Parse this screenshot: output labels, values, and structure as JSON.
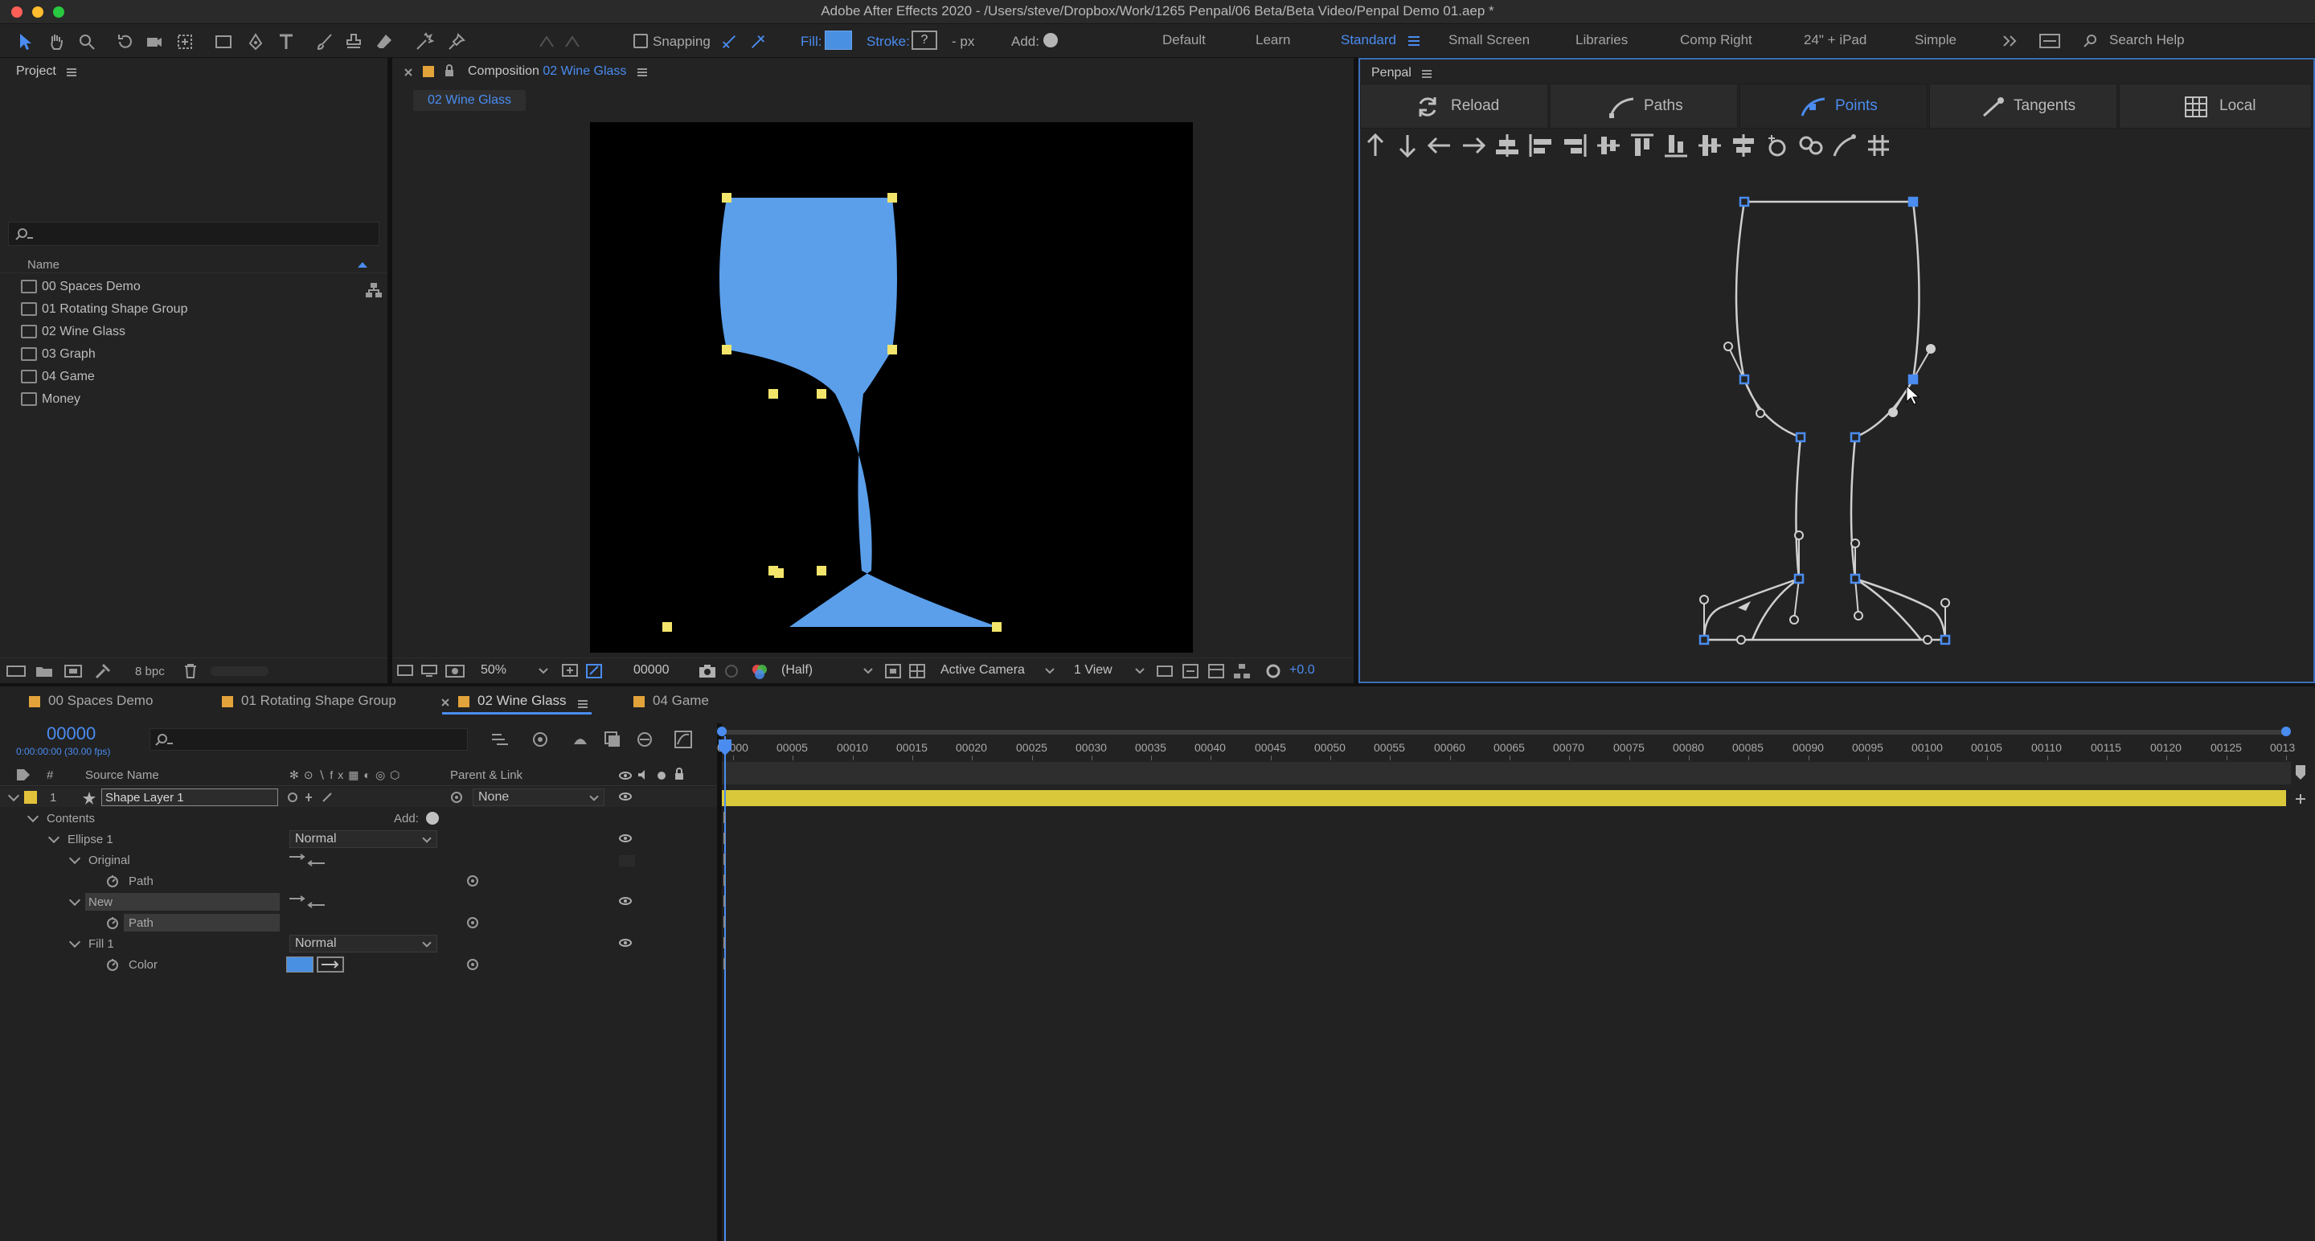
{
  "window": {
    "title": "Adobe After Effects 2020 - /Users/steve/Dropbox/Work/1265 Penpal/06 Beta/Beta Video/Penpal Demo 01.aep *"
  },
  "toolbar": {
    "snapping_label": "Snapping",
    "fill_label": "Fill:",
    "stroke_label": "Stroke:",
    "stroke_unit": "- px",
    "add_label": "Add:",
    "workspaces": [
      "Default",
      "Learn",
      "Standard",
      "Small Screen",
      "Libraries",
      "Comp Right",
      "24\" + iPad",
      "Simple"
    ],
    "active_workspace": "Standard",
    "search_placeholder": "Search Help",
    "fill_color": "#4a90e2"
  },
  "project_panel": {
    "title": "Project",
    "column_name": "Name",
    "items": [
      "00 Spaces Demo",
      "01 Rotating Shape Group",
      "02 Wine Glass",
      "03 Graph",
      "04 Game",
      "Money"
    ],
    "bpc": "8 bpc"
  },
  "composition_panel": {
    "title_prefix": "Composition",
    "comp_name": "02 Wine Glass",
    "breadcrumb": "02 Wine Glass",
    "zoom": "50%",
    "timecode": "00000",
    "resolution": "(Half)",
    "camera": "Active Camera",
    "view": "1 View",
    "exposure": "+0.0",
    "shape_color": "#5b9fea",
    "vertex_color": "#f3e56b"
  },
  "penpal_panel": {
    "title": "Penpal",
    "buttons": [
      "Reload",
      "Paths",
      "Points",
      "Tangents",
      "Local"
    ],
    "active_button": "Points",
    "accent": "#4a8cf0"
  },
  "timeline": {
    "tabs": [
      "00 Spaces Demo",
      "01 Rotating Shape Group",
      "02 Wine Glass",
      "04 Game"
    ],
    "active_tab": "02 Wine Glass",
    "timecode": "00000",
    "timecode_sub": "0:00:00:00 (30.00 fps)",
    "col_source_name": "Source Name",
    "col_parent": "Parent & Link",
    "layer_number": "1",
    "layer_name": "Shape Layer 1",
    "parent_value": "None",
    "contents_label": "Contents",
    "add_label": "Add:",
    "ellipse_label": "Ellipse 1",
    "blend_mode_1": "Normal",
    "original_label": "Original",
    "path_label_1": "Path",
    "new_label": "New",
    "path_label_2": "Path",
    "fill_label": "Fill 1",
    "blend_mode_2": "Normal",
    "color_label": "Color",
    "ruler": [
      "00000",
      "00005",
      "00010",
      "00015",
      "00020",
      "00025",
      "00030",
      "00035",
      "00040",
      "00045",
      "00050",
      "00055",
      "00060",
      "00065",
      "00070",
      "00075",
      "00080",
      "00085",
      "00090",
      "00095",
      "00100",
      "00105",
      "00110",
      "00115",
      "00120",
      "00125",
      "0013"
    ],
    "layer_bar_color": "#d9c83a"
  }
}
